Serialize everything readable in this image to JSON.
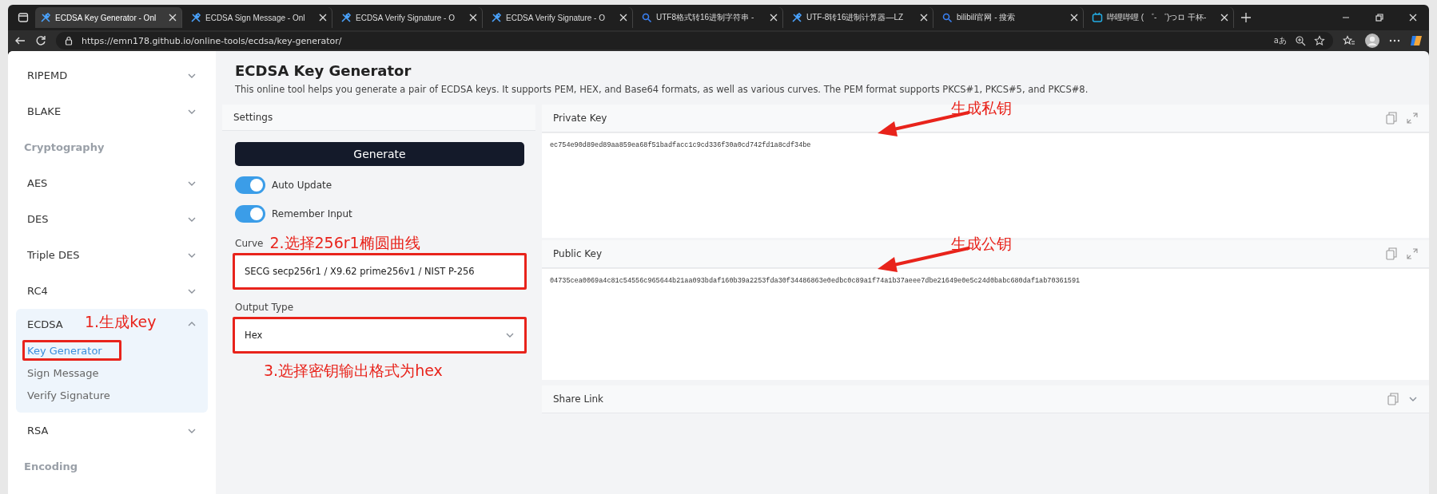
{
  "browser": {
    "tabs": [
      {
        "title": "ECDSA Key Generator - Onl",
        "kind": "tool",
        "selected": true
      },
      {
        "title": "ECDSA Sign Message - Onl",
        "kind": "tool",
        "selected": false
      },
      {
        "title": "ECDSA Verify Signature - O",
        "kind": "tool",
        "selected": false
      },
      {
        "title": "ECDSA Verify Signature - O",
        "kind": "tool",
        "selected": false
      },
      {
        "title": "UTF8格式转16进制字符串 -",
        "kind": "search",
        "selected": false
      },
      {
        "title": "UTF-8转16进制计算器—LZ",
        "kind": "tool",
        "selected": false
      },
      {
        "title": "bilibili官网 - 搜索",
        "kind": "search",
        "selected": false
      },
      {
        "title": "哔哩哔哩 ( ゜- ゜)つロ 干杯-",
        "kind": "tv",
        "selected": false
      }
    ],
    "url": "https://emn178.github.io/online-tools/ecdsa/key-generator/",
    "read_aloud": "aあ"
  },
  "sidebar": {
    "items": [
      {
        "kind": "group",
        "label": "RIPEMD",
        "expanded": false
      },
      {
        "kind": "group",
        "label": "BLAKE",
        "expanded": false
      },
      {
        "kind": "heading",
        "label": "Cryptography"
      },
      {
        "kind": "group",
        "label": "AES",
        "expanded": false
      },
      {
        "kind": "group",
        "label": "DES",
        "expanded": false
      },
      {
        "kind": "group",
        "label": "Triple DES",
        "expanded": false
      },
      {
        "kind": "group",
        "label": "RC4",
        "expanded": false
      },
      {
        "kind": "group",
        "label": "ECDSA",
        "expanded": true,
        "annotation": "1.生成key",
        "children": [
          {
            "label": "Key Generator",
            "selected": true,
            "highlighted": true
          },
          {
            "label": "Sign Message",
            "selected": false,
            "highlighted": false
          },
          {
            "label": "Verify Signature",
            "selected": false,
            "highlighted": false
          }
        ]
      },
      {
        "kind": "group",
        "label": "RSA",
        "expanded": false
      },
      {
        "kind": "heading",
        "label": "Encoding"
      }
    ]
  },
  "page": {
    "title": "ECDSA Key Generator",
    "description": "This online tool helps you generate a pair of ECDSA keys. It supports PEM, HEX, and Base64 formats, as well as various curves. The PEM format supports PKCS#1, PKCS#5, and PKCS#8."
  },
  "settings": {
    "title": "Settings",
    "generate_button": "Generate",
    "toggles": [
      {
        "label": "Auto Update",
        "on": true
      },
      {
        "label": "Remember Input",
        "on": true
      }
    ],
    "fields": [
      {
        "label": "Curve",
        "value": "SECG secp256r1 / X9.62 prime256v1 / NIST P-256",
        "chevron": false,
        "highlighted": true,
        "annotation": "2.选择256r1椭圆曲线"
      },
      {
        "label": "Output Type",
        "value": "Hex",
        "chevron": true,
        "highlighted": true,
        "annotation": "3.选择密钥输出格式为hex"
      }
    ]
  },
  "outputs": [
    {
      "title": "Private Key",
      "value": "ec754e90d89ed89aa859ea68f51badfacc1c9cd336f30a0cd742fd1a8cdf34be",
      "annotation": "生成私钥",
      "collapsed": false
    },
    {
      "title": "Public Key",
      "value": "04735cea0069a4c81c54556c965644b21aa093bdaf160b39a2253fda30f34486863e0edbc0c89a1f74a1b37aeee7dbe21649e0e5c24d0babc680daf1ab70361591",
      "annotation": "生成公钥",
      "collapsed": false
    },
    {
      "title": "Share Link",
      "collapsed": true
    }
  ]
}
